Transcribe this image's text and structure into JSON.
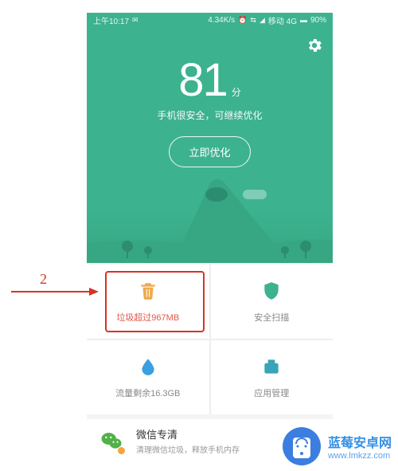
{
  "status_bar": {
    "time": "上午10:17",
    "speed": "4.34K/s",
    "network": "移动 4G",
    "battery": "90%"
  },
  "hero": {
    "score": "81",
    "unit": "分",
    "subtitle": "手机很安全，可继续优化",
    "button": "立即优化"
  },
  "tiles": {
    "trash": {
      "label": "垃圾超过967MB"
    },
    "scan": {
      "label": "安全扫描"
    },
    "data": {
      "label": "流量剩余16.3GB"
    },
    "apps": {
      "label": "应用管理"
    }
  },
  "wechat": {
    "title": "微信专清",
    "subtitle": "清理微信垃圾，释放手机内存"
  },
  "annotation": {
    "num": "2"
  },
  "watermark": {
    "name": "蓝莓安卓网",
    "url": "www.lmkzz.com"
  },
  "colors": {
    "primary": "#3db28e",
    "danger": "#d63324"
  }
}
